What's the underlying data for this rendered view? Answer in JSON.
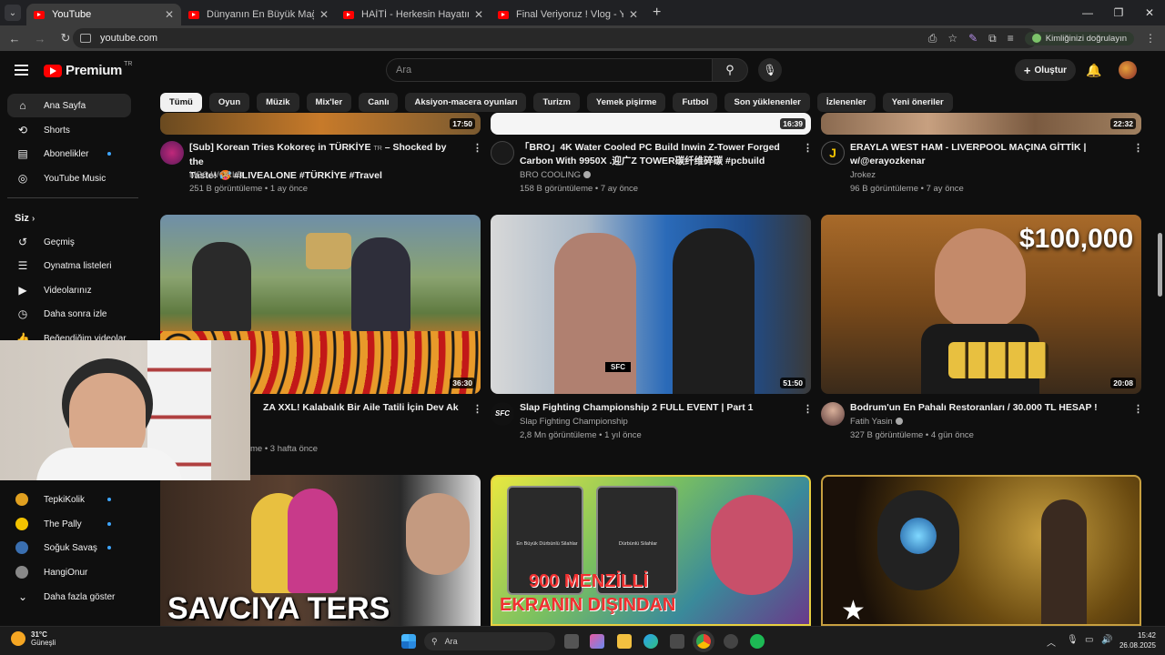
{
  "browser": {
    "tabs": [
      {
        "title": "YouTube",
        "active": true
      },
      {
        "title": "Dünyanın En Büyük Mağarası:",
        "active": false
      },
      {
        "title": "HAİTİ - Herkesin Hayatını Satt",
        "active": false
      },
      {
        "title": "Final Veriyoruz ! Vlog - YouTube",
        "active": false
      }
    ],
    "url": "youtube.com",
    "verify_label": "Kimliğinizi doğrulayın"
  },
  "header": {
    "logo_text": "Premium",
    "logo_sup": "TR",
    "search_placeholder": "Ara",
    "create_label": "Oluştur"
  },
  "sidebar": {
    "main": [
      {
        "label": "Ana Sayfa",
        "icon": "home-icon"
      },
      {
        "label": "Shorts",
        "icon": "shorts-icon"
      },
      {
        "label": "Abonelikler",
        "icon": "subscriptions-icon"
      },
      {
        "label": "YouTube Music",
        "icon": "music-icon"
      }
    ],
    "you_heading": "Siz",
    "you": [
      {
        "label": "Geçmiş",
        "icon": "history-icon"
      },
      {
        "label": "Oynatma listeleri",
        "icon": "playlist-icon"
      },
      {
        "label": "Videolarınız",
        "icon": "your-videos-icon"
      },
      {
        "label": "Daha sonra izle",
        "icon": "watch-later-icon"
      },
      {
        "label": "Beğendiğim videolar",
        "icon": "like-icon"
      }
    ],
    "channels": [
      {
        "label": "TepkiKolik",
        "color": "#e0a020"
      },
      {
        "label": "The Pally",
        "color": "#f2c200"
      },
      {
        "label": "Soğuk Savaş",
        "color": "#3a6fb0"
      },
      {
        "label": "HangiOnur",
        "color": "#888888"
      }
    ],
    "more_label": "Daha fazla göster"
  },
  "chips": [
    "Tümü",
    "Oyun",
    "Müzik",
    "Mix'ler",
    "Canlı",
    "Aksiyon-macera oyunları",
    "Turizm",
    "Yemek pişirme",
    "Futbol",
    "Son yüklenenler",
    "İzlenenler",
    "Yeni öneriler"
  ],
  "videos": {
    "r1": [
      {
        "duration": "17:50",
        "title1": "[Sub] Korean Tries Kokoreç in TÜRKİYE",
        "tag": "TR",
        "title1b": "– Shocked by the",
        "title2": "Taste! 🥵 #ILIVEALONE #TÜRKİYE #Travel",
        "channel": "MBC WORLD",
        "meta": "251 B görüntüleme • 1 ay önce"
      },
      {
        "duration": "16:39",
        "title1": "「BRO」4K Water Cooled PC Build Inwin Z-Tower  Forged",
        "title2": "Carbon With 9950X .迎广Z TOWER碳纤维碎碳 #pcbuild",
        "channel": "BRO COOLING",
        "meta": "158 B görüntüleme • 7 ay önce"
      },
      {
        "duration": "22:32",
        "title1": "ERAYLA WEST HAM - LIVERPOOL MAÇINA GİTTİK |",
        "title2": "w/@erayozkenar",
        "channel": "Jrokez",
        "meta": "96 B görüntüleme • 7 ay önce"
      }
    ],
    "r2": [
      {
        "duration": "36:30",
        "title1": "ZA XXL! Kalabalık Bir Aile Tatili İçin Dev Akşam",
        "meta": "me • 3 hafta önce"
      },
      {
        "duration": "51:50",
        "title1": "Slap Fighting Championship 2 FULL EVENT | Part 1",
        "channel": "Slap Fighting Championship",
        "meta": "2,8 Mn görüntüleme • 1 yıl önce",
        "overlay": "SFC"
      },
      {
        "duration": "20:08",
        "title1": "Bodrum'un En Pahalı Restoranları / 30.000 TL HESAP !",
        "channel": "Fatih Yasin",
        "meta": "327 B görüntüleme • 4 gün önce",
        "overlay": "$100,000"
      }
    ],
    "r3": [
      {
        "overlay": "SAVCIYA TERS"
      },
      {
        "overlay1": "900 MENZİLLİ",
        "overlay2": "EKRANIN DIŞINDAN",
        "card1": "En Büyük Dürbünlü Silahlar",
        "card2": "Dürbünlü Silahlar"
      },
      {}
    ]
  },
  "taskbar": {
    "temp": "31°C",
    "weather": "Güneşli",
    "search": "Ara",
    "time": "15:42",
    "date": "26.08.2025"
  }
}
